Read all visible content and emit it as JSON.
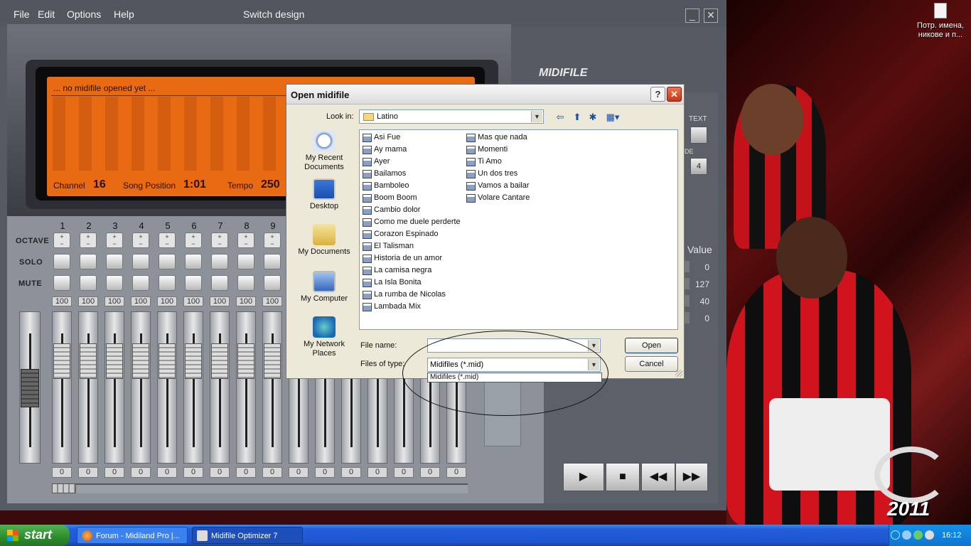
{
  "app": {
    "menu": [
      "File",
      "Edit",
      "Options",
      "Help"
    ],
    "switch_design": "Switch design",
    "minimize": "_",
    "close": "✕",
    "logo_line1": "MIDIFILE",
    "lcd": {
      "status": "... no midifile opened yet ...",
      "channel_label": "Channel",
      "channel_value": "16",
      "song_position_label": "Song Position",
      "song_position_value": "1:01",
      "tempo_label": "Tempo",
      "tempo_value": "250"
    },
    "row_labels": {
      "octave": "OCTAVE",
      "solo": "SOLO",
      "mute": "MUTE"
    },
    "channels": [
      "1",
      "2",
      "3",
      "4",
      "5",
      "6",
      "7",
      "8",
      "9"
    ],
    "volumes": [
      "100",
      "100",
      "100",
      "100",
      "100",
      "100",
      "100",
      "100",
      "100"
    ],
    "bottom_values": [
      "0",
      "0",
      "0",
      "0",
      "0",
      "0",
      "0",
      "0",
      "0",
      "0",
      "0",
      "0",
      "0",
      "0",
      "0",
      "0"
    ],
    "right_panel": {
      "text_label": "TEXT",
      "de_label": "DE",
      "number_button": "4",
      "value_label": "Value",
      "values": [
        "0",
        "127",
        "40",
        "0"
      ]
    },
    "transport": {
      "play": "▶",
      "stop": "■",
      "rewind": "◀◀",
      "forward": "▶▶"
    }
  },
  "dialog": {
    "title": "Open midifile",
    "help": "?",
    "close": "✕",
    "look_in_label": "Look in:",
    "look_in_value": "Latino",
    "places": [
      "My Recent Documents",
      "Desktop",
      "My Documents",
      "My Computer",
      "My Network Places"
    ],
    "files_col1": [
      "Asi Fue",
      "Ay mama",
      "Ayer",
      "Bailamos",
      "Bamboleo",
      "Boom Boom",
      "Cambio dolor",
      "Como me duele perderte",
      "Corazon Espinado",
      "El Talisman",
      "Historia de un amor",
      "La camisa negra",
      "La Isla Bonita",
      "La rumba de Nicolas",
      "Lambada Mix"
    ],
    "files_col2": [
      "Mas que nada",
      "Momenti",
      "Ti Amo",
      "Un dos tres",
      "Vamos a bailar",
      "Volare Cantare"
    ],
    "file_name_label": "File name:",
    "file_name_value": "",
    "files_of_type_label": "Files of type:",
    "files_of_type_value": "Midifiles (*.mid)",
    "files_of_type_option": "Midifiles (*.mid)",
    "open_button": "Open",
    "cancel_button": "Cancel"
  },
  "desktop": {
    "icon_label": "Потр. имена, никове и п...",
    "logo_year": "2011"
  },
  "taskbar": {
    "start": "start",
    "tasks": [
      "Forum - Midiland Pro |...",
      "Midifile Optimizer 7"
    ],
    "clock": "16:12"
  },
  "colors": {
    "lcd": "#e86a12",
    "taskbar": "#245edb",
    "start": "#2e8b2e"
  }
}
